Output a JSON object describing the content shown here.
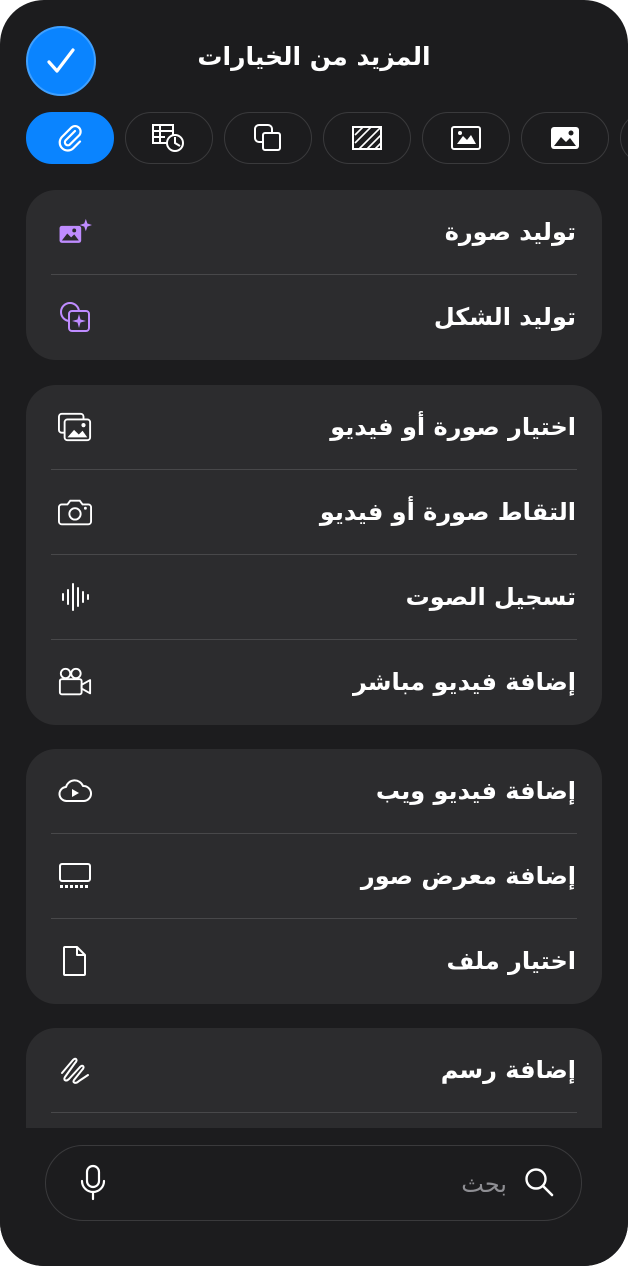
{
  "header": {
    "title": "المزيد من الخيارات",
    "done_icon": "checkmark-icon"
  },
  "tabs": [
    {
      "icon": "paperclip-icon",
      "active": true
    },
    {
      "icon": "table-chart-icon",
      "active": false
    },
    {
      "icon": "shapes-icon",
      "active": false
    },
    {
      "icon": "pattern-fill-icon",
      "active": false
    },
    {
      "icon": "image-fill-icon",
      "active": false
    },
    {
      "icon": "photo-icon",
      "active": false
    }
  ],
  "groups": [
    {
      "items": [
        {
          "label": "توليد صورة",
          "icon": "image-sparkle-icon"
        },
        {
          "label": "توليد الشكل",
          "icon": "shape-sparkle-icon"
        }
      ]
    },
    {
      "items": [
        {
          "label": "اختيار صورة أو فيديو",
          "icon": "photo-library-icon"
        },
        {
          "label": "التقاط صورة أو فيديو",
          "icon": "camera-icon"
        },
        {
          "label": "تسجيل الصوت",
          "icon": "waveform-icon"
        },
        {
          "label": "إضافة فيديو مباشر",
          "icon": "video-camera-icon"
        }
      ]
    },
    {
      "items": [
        {
          "label": "إضافة فيديو ويب",
          "icon": "cloud-play-icon"
        },
        {
          "label": "إضافة معرض صور",
          "icon": "gallery-icon"
        },
        {
          "label": "اختيار ملف",
          "icon": "document-icon"
        }
      ]
    },
    {
      "items": [
        {
          "label": "إضافة رسم",
          "icon": "scribble-icon"
        }
      ]
    }
  ],
  "search": {
    "placeholder": "بحث",
    "search_icon": "search-icon",
    "mic_icon": "microphone-icon"
  },
  "colors": {
    "accent": "#0a84ff",
    "sheet": "#1c1c1e",
    "card": "#2c2c2e",
    "ai_icon": "#bf8cff"
  }
}
